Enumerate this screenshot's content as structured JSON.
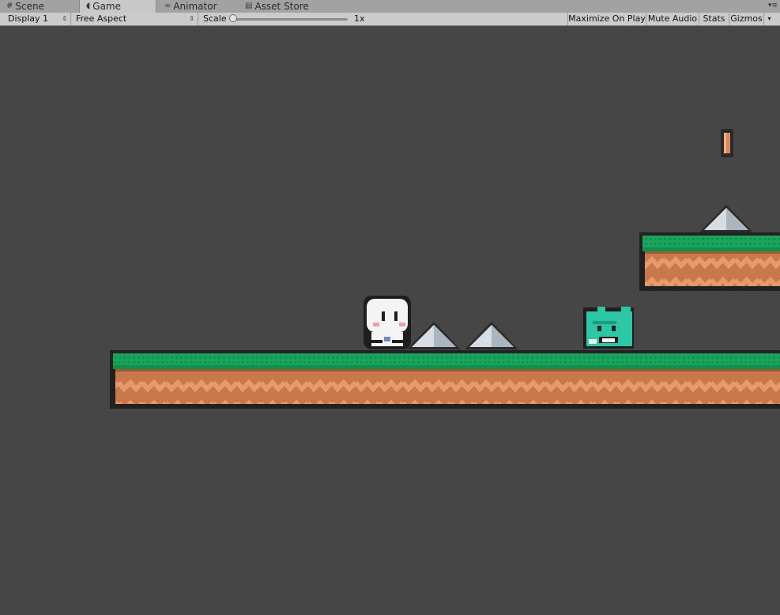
{
  "tabs": [
    {
      "label": "Scene",
      "icon": "grid-icon",
      "active": false
    },
    {
      "label": "Game",
      "icon": "pacman-icon",
      "active": true
    },
    {
      "label": "Animator",
      "icon": "animator-icon",
      "active": false
    },
    {
      "label": "Asset Store",
      "icon": "store-icon",
      "active": false
    }
  ],
  "toolbar": {
    "display": "Display 1",
    "aspect": "Free Aspect",
    "scale_label": "Scale",
    "scale_value": "1x",
    "maximize": "Maximize On Play",
    "mute": "Mute Audio",
    "stats": "Stats",
    "gizmos": "Gizmos"
  },
  "colors": {
    "background": "#464646",
    "grass": "#19a05a",
    "dirt": "#c8784a",
    "dirt_zigzag": "#e89b6a",
    "spike": "#d6dde4",
    "slime": "#2ec7a6"
  }
}
